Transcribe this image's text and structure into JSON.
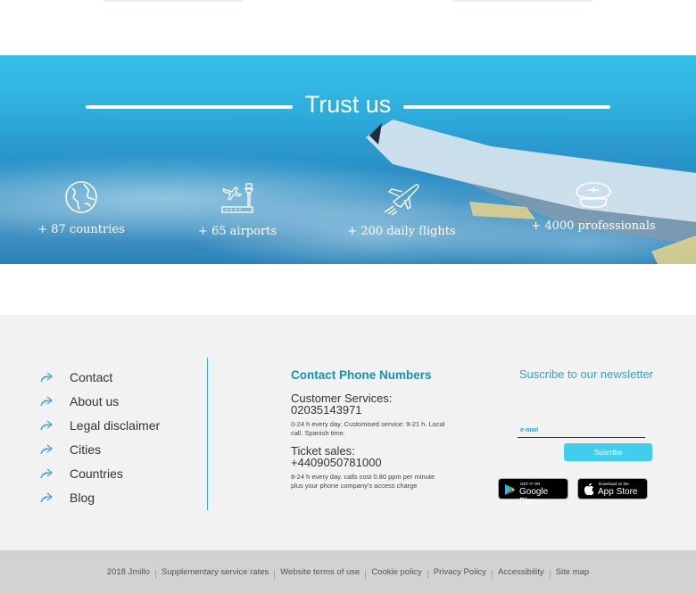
{
  "hero": {
    "title": "Trust us",
    "stats": [
      {
        "icon": "globe-icon",
        "label": "+ 87 countries"
      },
      {
        "icon": "airport-icon",
        "label": "+ 65 airports"
      },
      {
        "icon": "departing-plane-icon",
        "label": "+ 200 daily flights"
      },
      {
        "icon": "pilot-cap-icon",
        "label": "+ 4000 professionals"
      }
    ]
  },
  "footer": {
    "links": [
      "Contact",
      "About us",
      "Legal disclaimer",
      "Cities",
      "Countries",
      "Blog"
    ],
    "contact": {
      "heading": "Contact Phone Numbers",
      "customer_title": "Customer Services:",
      "customer_phone": "02035143971",
      "customer_note": "0-24 h every day. Customised service: 9-21 h. Local call. Spanish time.",
      "tickets_title": "Ticket sales:",
      "tickets_phone": "+4409050781000",
      "tickets_note": "8-24 h every day. calls cost 0.80 ppm per minute plus your phone company's access charge"
    },
    "newsletter": {
      "title": "Suscribe to our newsletter",
      "email_placeholder": "e-mail",
      "button_label": "Suscribe"
    },
    "stores": {
      "google_small": "GET IT ON",
      "google_large": "Google Play",
      "apple_small": "Download on the",
      "apple_large": "App Store"
    }
  },
  "bottom_bar": {
    "links": [
      "2018 Jmillo",
      "Supplementary service rates",
      "Website terms of use",
      "Cookie policy",
      "Privacy Policy",
      "Accessibility",
      "Site map"
    ]
  },
  "colors": {
    "accent": "#2aa6cc",
    "button": "#3fcfec",
    "footer_bg": "#f2f2f2",
    "bottom_bg": "#d2d2d2"
  }
}
